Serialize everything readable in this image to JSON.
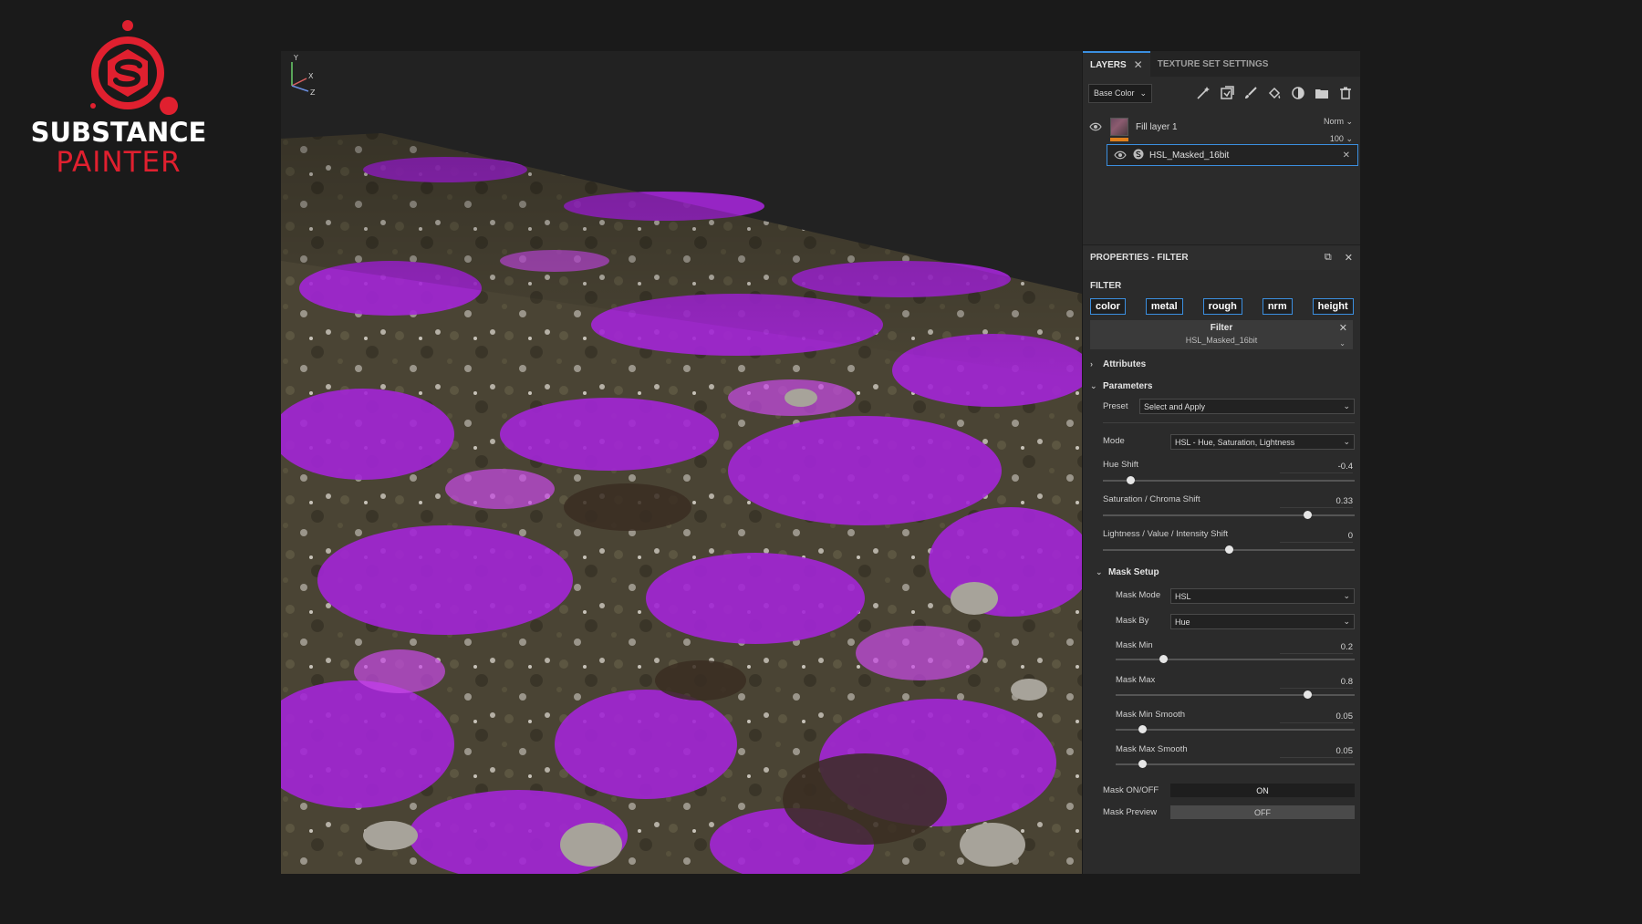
{
  "logo": {
    "line1": "SUBSTANCE",
    "line2": "PAINTER",
    "brand_color": "#e0202f"
  },
  "tabs": [
    {
      "label": "LAYERS",
      "active": true,
      "closable": true
    },
    {
      "label": "TEXTURE SET SETTINGS",
      "active": false
    }
  ],
  "toolbar": {
    "channel": "Base Color",
    "icons": [
      "magic-wand-icon",
      "generator-icon",
      "paint-brush-icon",
      "fill-bucket-icon",
      "smart-material-icon",
      "folder-icon",
      "trash-icon"
    ]
  },
  "layers": {
    "fill_layer": {
      "name": "Fill layer 1",
      "blend": "Norm",
      "opacity": "100"
    },
    "effect": {
      "name": "HSL_Masked_16bit"
    }
  },
  "properties": {
    "title": "PROPERTIES - FILTER",
    "section": "FILTER",
    "channels": [
      "color",
      "metal",
      "rough",
      "nrm",
      "height"
    ],
    "filter_box": {
      "title": "Filter",
      "name": "HSL_Masked_16bit"
    },
    "attributes_label": "Attributes",
    "parameters_label": "Parameters",
    "preset": {
      "label": "Preset",
      "value": "Select and Apply"
    },
    "mode": {
      "label": "Mode",
      "value": "HSL - Hue, Saturation, Lightness"
    },
    "sliders": [
      {
        "label": "Hue Shift",
        "value": "-0.4",
        "fraction": 0.11
      },
      {
        "label": "Saturation / Chroma Shift",
        "value": "0.33",
        "fraction": 0.81
      },
      {
        "label": "Lightness / Value / Intensity Shift",
        "value": "0",
        "fraction": 0.5
      }
    ],
    "mask_setup": {
      "label": "Mask Setup",
      "mask_mode": {
        "label": "Mask Mode",
        "value": "HSL"
      },
      "mask_by": {
        "label": "Mask By",
        "value": "Hue"
      },
      "sliders": [
        {
          "label": "Mask Min",
          "value": "0.2",
          "fraction": 0.2
        },
        {
          "label": "Mask Max",
          "value": "0.8",
          "fraction": 0.8
        },
        {
          "label": "Mask Min Smooth",
          "value": "0.05",
          "fraction": 0.11
        },
        {
          "label": "Mask Max Smooth",
          "value": "0.05",
          "fraction": 0.11
        }
      ]
    },
    "mask_onoff": {
      "label": "Mask ON/OFF",
      "value": "ON"
    },
    "mask_preview": {
      "label": "Mask Preview",
      "value": "OFF"
    }
  },
  "gizmo": {
    "y": "Y",
    "x": "X",
    "z": "Z"
  },
  "colors": {
    "accent": "#3b8fe0",
    "panel": "#2b2b2b",
    "background": "#1a1a1a"
  }
}
